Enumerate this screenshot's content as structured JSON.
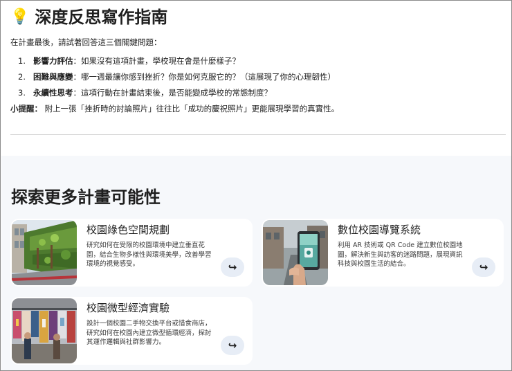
{
  "guide": {
    "icon": "lightbulb-icon",
    "title": "深度反思寫作指南",
    "intro": "在計畫最後，請試著回答這三個關鍵問題：",
    "questions": [
      {
        "num": "1.",
        "label": "影響力評估",
        "text": "：如果沒有這項計畫，學校現在會是什麼樣子？"
      },
      {
        "num": "2.",
        "label": "困難與應變",
        "text": "：哪一週最讓你感到挫折？你是如何克服它的？（這展現了你的心理韌性）"
      },
      {
        "num": "3.",
        "label": "永續性思考",
        "text": "：這項行動在計畫結束後，是否能變成學校的常態制度？"
      }
    ],
    "tip_label": "小提醒：",
    "tip_text": " 附上一張「挫折時的討論照片」往往比「成功的慶祝照片」更能展現學習的真實性。"
  },
  "explore": {
    "title": "探索更多計畫可能性",
    "cards": [
      {
        "title": "校園綠色空間規劃",
        "desc": "研究如何在受限的校園環境中建立垂直花園，結合生物多樣性與環境美學，改善學習環境的視覺感受。",
        "action_icon": "arrow-return-icon"
      },
      {
        "title": "數位校園導覽系統",
        "desc": "利用 AR 技術或 QR Code 建立數位校園地圖，解決新生與訪客的迷路問題，展現資訊科技與校園生活的結合。",
        "action_icon": "arrow-return-icon"
      },
      {
        "title": "校園微型經濟實驗",
        "desc": "設計一個校園二手物交換平台或惜食商店，研究如何在校園內建立微型循環經濟，探討其運作邏輯與社群影響力。",
        "action_icon": "arrow-return-icon"
      }
    ]
  },
  "colors": {
    "section_bg": "#f6f8fb",
    "card_bg": "#ffffff",
    "button_bg": "#e7edf6",
    "divider": "#d4d4d4"
  }
}
